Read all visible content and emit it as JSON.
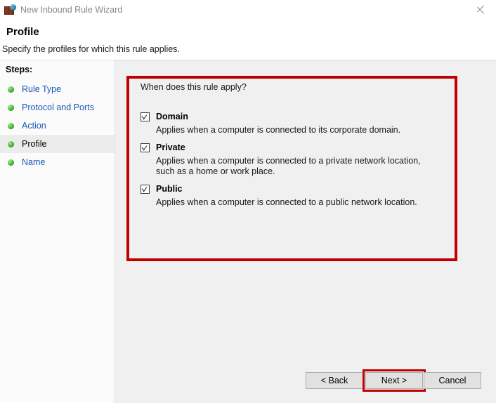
{
  "window": {
    "title": "New Inbound Rule Wizard",
    "icon": "firewall-globe-icon",
    "close_label": "✕"
  },
  "header": {
    "title": "Profile",
    "subtitle": "Specify the profiles for which this rule applies."
  },
  "sidebar": {
    "header": "Steps:",
    "items": [
      {
        "label": "Rule Type",
        "current": false
      },
      {
        "label": "Protocol and Ports",
        "current": false
      },
      {
        "label": "Action",
        "current": false
      },
      {
        "label": "Profile",
        "current": true
      },
      {
        "label": "Name",
        "current": false
      }
    ]
  },
  "main": {
    "question": "When does this rule apply?",
    "options": [
      {
        "label": "Domain",
        "checked": true,
        "description": "Applies when a computer is connected to its corporate domain."
      },
      {
        "label": "Private",
        "checked": true,
        "description": "Applies when a computer is connected to a private network location, such as a home or work place."
      },
      {
        "label": "Public",
        "checked": true,
        "description": "Applies when a computer is connected to a public network location."
      }
    ]
  },
  "footer": {
    "back_label": "< Back",
    "next_label": "Next >",
    "cancel_label": "Cancel"
  },
  "highlights": {
    "color": "#c00000",
    "targets": [
      "profile-options-group",
      "next-button"
    ]
  }
}
